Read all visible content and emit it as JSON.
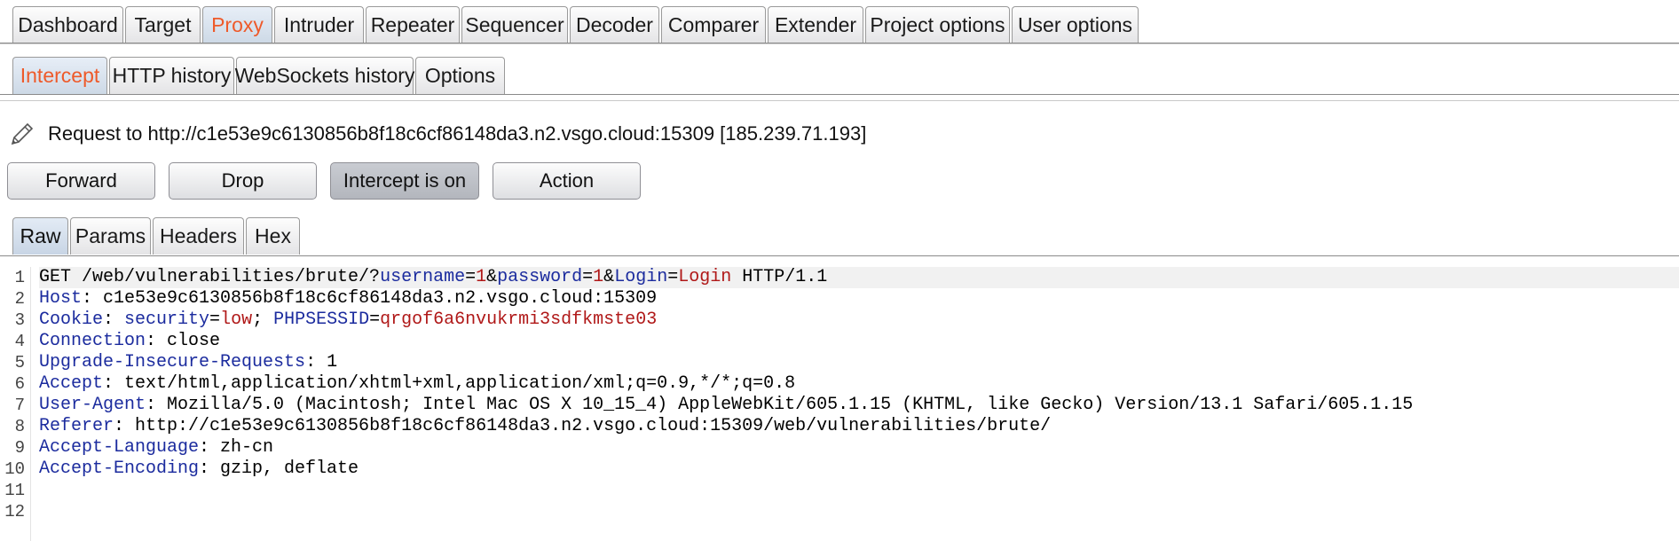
{
  "main_tabs": [
    "Dashboard",
    "Target",
    "Proxy",
    "Intruder",
    "Repeater",
    "Sequencer",
    "Decoder",
    "Comparer",
    "Extender",
    "Project options",
    "User options"
  ],
  "proxy_tabs": [
    "Intercept",
    "HTTP history",
    "WebSockets history",
    "Options"
  ],
  "request": {
    "label": "Request to http://c1e53e9c6130856b8f18c6cf86148da3.n2.vsgo.cloud:15309  [185.239.71.193]",
    "icon": "pencil-icon"
  },
  "buttons": {
    "forward": "Forward",
    "drop": "Drop",
    "intercept": "Intercept is on",
    "action": "Action"
  },
  "view_tabs": [
    "Raw",
    "Params",
    "Headers",
    "Hex"
  ],
  "editor": {
    "line_numbers": [
      "1",
      "2",
      "3",
      "4",
      "5",
      "6",
      "7",
      "8",
      "9",
      "10",
      "11",
      "12"
    ],
    "line1": {
      "method": "GET /web/vulnerabilities/brute/?",
      "p1k": "username",
      "eq1": "=",
      "p1v": "1",
      "amp1": "&",
      "p2k": "password",
      "eq2": "=",
      "p2v": "1",
      "amp2": "&",
      "p3k": "Login",
      "eq3": "=",
      "p3v": "Login",
      "proto": " HTTP/1.1"
    },
    "host": {
      "name": "Host",
      "value": ": c1e53e9c6130856b8f18c6cf86148da3.n2.vsgo.cloud:15309"
    },
    "cookie": {
      "name": "Cookie",
      "sep": ": ",
      "c1k": "security",
      "eq1": "=",
      "c1v": "low",
      "semi": "; ",
      "c2k": "PHPSESSID",
      "eq2": "=",
      "c2v": "qrgof6a6nvukrmi3sdfkmste03"
    },
    "connection": {
      "name": "Connection",
      "value": ": close"
    },
    "upgrade": {
      "name": "Upgrade-Insecure-Requests",
      "value": ": 1"
    },
    "accept": {
      "name": "Accept",
      "value": ": text/html,application/xhtml+xml,application/xml;q=0.9,*/*;q=0.8"
    },
    "user_agent": {
      "name": "User-Agent",
      "value": ": Mozilla/5.0 (Macintosh; Intel Mac OS X 10_15_4) AppleWebKit/605.1.15 (KHTML, like Gecko) Version/13.1 Safari/605.1.15"
    },
    "referer": {
      "name": "Referer",
      "value": ": http://c1e53e9c6130856b8f18c6cf86148da3.n2.vsgo.cloud:15309/web/vulnerabilities/brute/"
    },
    "accept_language": {
      "name": "Accept-Language",
      "value": ": zh-cn"
    },
    "accept_encoding": {
      "name": "Accept-Encoding",
      "value": ": gzip, deflate"
    }
  },
  "colors": {
    "accent": "#ee5a2a",
    "header_key": "#1b2b9e",
    "param_value": "#b01818"
  }
}
